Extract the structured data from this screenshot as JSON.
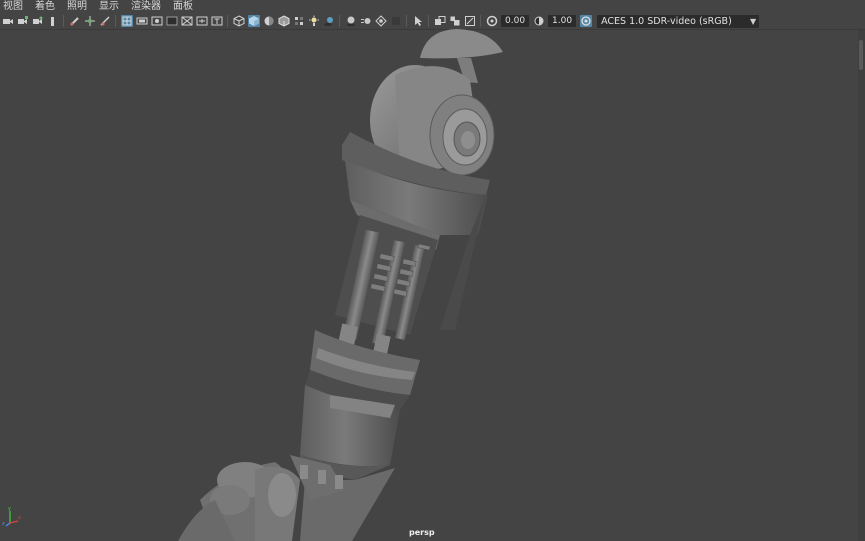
{
  "menu": {
    "items": [
      {
        "label": "视图"
      },
      {
        "label": "着色"
      },
      {
        "label": "照明"
      },
      {
        "label": "显示"
      },
      {
        "label": "渲染器"
      },
      {
        "label": "面板"
      }
    ]
  },
  "toolbar": {
    "exposure_value": "0.00",
    "gamma_value": "1.00",
    "color_space": "ACES 1.0 SDR-video (sRGB)",
    "icons": [
      "camera-icon",
      "camera-attributes-icon",
      "camera-bookmark-icon",
      "image-plane-icon",
      "grease-pencil-icon",
      "two-d-pan-zoom-icon",
      "isolate-icon",
      "grid-icon",
      "film-gate-icon",
      "resolution-gate-icon",
      "gate-mask-icon",
      "field-chart-icon",
      "safe-action-icon",
      "safe-title-icon",
      "wireframe-icon",
      "smooth-shade-icon",
      "default-material-icon",
      "wireframe-on-shaded-icon",
      "textured-icon",
      "use-lights-icon",
      "shadows-icon",
      "screen-space-ao-icon",
      "motion-blur-icon",
      "multisample-aa-icon",
      "depth-of-field-icon",
      "xray-icon",
      "xray-joints-icon",
      "backface-culling-icon",
      "exposure-icon",
      "gamma-icon",
      "color-management-icon"
    ],
    "accent_color": "#5285a6"
  },
  "viewport": {
    "camera_name": "persp",
    "background_color": "#444444"
  },
  "axis": {
    "x_label": "x",
    "y_label": "y",
    "z_label": "z"
  }
}
